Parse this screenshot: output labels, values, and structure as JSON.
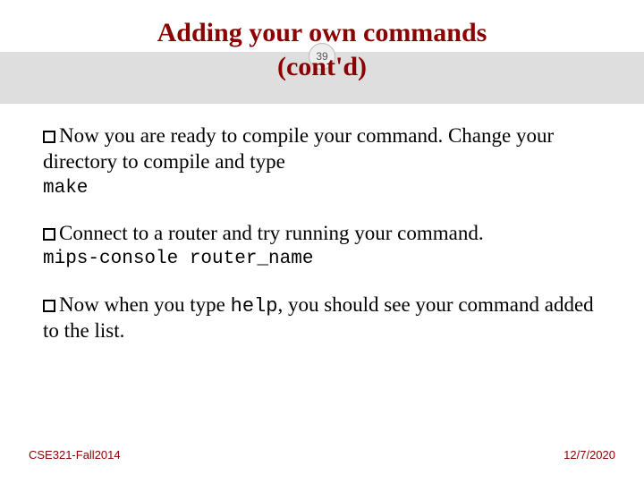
{
  "title": {
    "line1": "Adding your own commands",
    "line2": "(cont'd)"
  },
  "page_number": "39",
  "bullets": [
    {
      "text_parts": [
        {
          "type": "text",
          "value": "Now you are ready to compile your command. Change your directory to compile and type"
        }
      ],
      "code_after": "make"
    },
    {
      "text_parts": [
        {
          "type": "text",
          "value": "Connect to a router and try running your command."
        }
      ],
      "code_after": "mips-console router_name"
    },
    {
      "text_parts": [
        {
          "type": "text",
          "value": "Now when you type "
        },
        {
          "type": "code",
          "value": "help"
        },
        {
          "type": "text",
          "value": ", you should see your command added to the list."
        }
      ],
      "code_after": null
    }
  ],
  "footer": {
    "left": "CSE321-Fall2014",
    "right": "12/7/2020"
  }
}
